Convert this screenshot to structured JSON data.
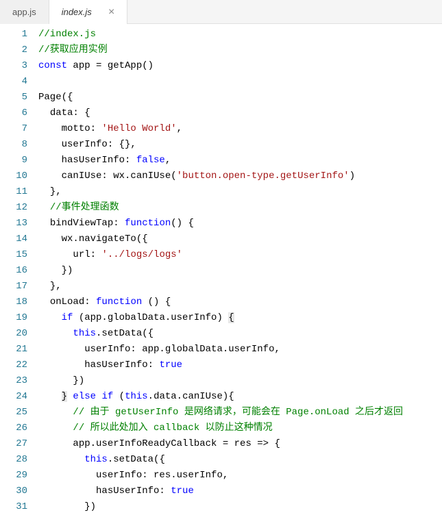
{
  "tabs": [
    {
      "label": "app.js",
      "active": false
    },
    {
      "label": "index.js",
      "active": true
    }
  ],
  "code_lines": [
    {
      "n": 1,
      "tokens": [
        {
          "t": "//index.js",
          "c": "comment"
        }
      ],
      "indent": 0
    },
    {
      "n": 2,
      "tokens": [
        {
          "t": "//获取应用实例",
          "c": "comment"
        }
      ],
      "indent": 0
    },
    {
      "n": 3,
      "tokens": [
        {
          "t": "const",
          "c": "keyword"
        },
        {
          "t": " app = getApp()",
          "c": "default"
        }
      ],
      "indent": 0
    },
    {
      "n": 4,
      "tokens": [],
      "indent": 0
    },
    {
      "n": 5,
      "tokens": [
        {
          "t": "Page({",
          "c": "default"
        }
      ],
      "indent": 0
    },
    {
      "n": 6,
      "tokens": [
        {
          "t": "data: {",
          "c": "default"
        }
      ],
      "indent": 1
    },
    {
      "n": 7,
      "tokens": [
        {
          "t": "motto: ",
          "c": "default"
        },
        {
          "t": "'Hello World'",
          "c": "string"
        },
        {
          "t": ",",
          "c": "default"
        }
      ],
      "indent": 2
    },
    {
      "n": 8,
      "tokens": [
        {
          "t": "userInfo: {},",
          "c": "default"
        }
      ],
      "indent": 2
    },
    {
      "n": 9,
      "tokens": [
        {
          "t": "hasUserInfo: ",
          "c": "default"
        },
        {
          "t": "false",
          "c": "boolean"
        },
        {
          "t": ",",
          "c": "default"
        }
      ],
      "indent": 2
    },
    {
      "n": 10,
      "tokens": [
        {
          "t": "canIUse: wx.canIUse(",
          "c": "default"
        },
        {
          "t": "'button.open-type.getUserInfo'",
          "c": "string"
        },
        {
          "t": ")",
          "c": "default"
        }
      ],
      "indent": 2
    },
    {
      "n": 11,
      "tokens": [
        {
          "t": "},",
          "c": "default"
        }
      ],
      "indent": 1
    },
    {
      "n": 12,
      "tokens": [
        {
          "t": "//事件处理函数",
          "c": "comment"
        }
      ],
      "indent": 1
    },
    {
      "n": 13,
      "tokens": [
        {
          "t": "bindViewTap: ",
          "c": "default"
        },
        {
          "t": "function",
          "c": "keyword"
        },
        {
          "t": "() {",
          "c": "default"
        }
      ],
      "indent": 1
    },
    {
      "n": 14,
      "tokens": [
        {
          "t": "wx.navigateTo({",
          "c": "default"
        }
      ],
      "indent": 2
    },
    {
      "n": 15,
      "tokens": [
        {
          "t": "url: ",
          "c": "default"
        },
        {
          "t": "'../logs/logs'",
          "c": "string"
        }
      ],
      "indent": 3
    },
    {
      "n": 16,
      "tokens": [
        {
          "t": "})",
          "c": "default"
        }
      ],
      "indent": 2
    },
    {
      "n": 17,
      "tokens": [
        {
          "t": "},",
          "c": "default"
        }
      ],
      "indent": 1
    },
    {
      "n": 18,
      "tokens": [
        {
          "t": "onLoad: ",
          "c": "default"
        },
        {
          "t": "function",
          "c": "keyword"
        },
        {
          "t": " () {",
          "c": "default"
        }
      ],
      "indent": 1
    },
    {
      "n": 19,
      "tokens": [
        {
          "t": "if",
          "c": "keyword"
        },
        {
          "t": " (app.globalData.userInfo) ",
          "c": "default"
        },
        {
          "t": "{",
          "c": "default",
          "hl": true
        }
      ],
      "indent": 2
    },
    {
      "n": 20,
      "tokens": [
        {
          "t": "this",
          "c": "keyword"
        },
        {
          "t": ".setData({",
          "c": "default"
        }
      ],
      "indent": 3
    },
    {
      "n": 21,
      "tokens": [
        {
          "t": "userInfo: app.globalData.userInfo,",
          "c": "default"
        }
      ],
      "indent": 4
    },
    {
      "n": 22,
      "tokens": [
        {
          "t": "hasUserInfo: ",
          "c": "default"
        },
        {
          "t": "true",
          "c": "boolean"
        }
      ],
      "indent": 4
    },
    {
      "n": 23,
      "tokens": [
        {
          "t": "})",
          "c": "default"
        }
      ],
      "indent": 3
    },
    {
      "n": 24,
      "tokens": [
        {
          "t": "}",
          "c": "default",
          "hl": true
        },
        {
          "t": " ",
          "c": "default"
        },
        {
          "t": "else",
          "c": "keyword"
        },
        {
          "t": " ",
          "c": "default"
        },
        {
          "t": "if",
          "c": "keyword"
        },
        {
          "t": " (",
          "c": "default"
        },
        {
          "t": "this",
          "c": "keyword"
        },
        {
          "t": ".data.canIUse){",
          "c": "default"
        }
      ],
      "indent": 2
    },
    {
      "n": 25,
      "tokens": [
        {
          "t": "// 由于 getUserInfo 是网络请求，可能会在 Page.onLoad 之后才返回",
          "c": "comment"
        }
      ],
      "indent": 3
    },
    {
      "n": 26,
      "tokens": [
        {
          "t": "// 所以此处加入 callback 以防止这种情况",
          "c": "comment"
        }
      ],
      "indent": 3
    },
    {
      "n": 27,
      "tokens": [
        {
          "t": "app.userInfoReadyCallback = res => {",
          "c": "default"
        }
      ],
      "indent": 3
    },
    {
      "n": 28,
      "tokens": [
        {
          "t": "this",
          "c": "keyword"
        },
        {
          "t": ".setData({",
          "c": "default"
        }
      ],
      "indent": 4
    },
    {
      "n": 29,
      "tokens": [
        {
          "t": "userInfo: res.userInfo,",
          "c": "default"
        }
      ],
      "indent": 5
    },
    {
      "n": 30,
      "tokens": [
        {
          "t": "hasUserInfo: ",
          "c": "default"
        },
        {
          "t": "true",
          "c": "boolean"
        }
      ],
      "indent": 5
    },
    {
      "n": 31,
      "tokens": [
        {
          "t": "})",
          "c": "default"
        }
      ],
      "indent": 4
    }
  ]
}
